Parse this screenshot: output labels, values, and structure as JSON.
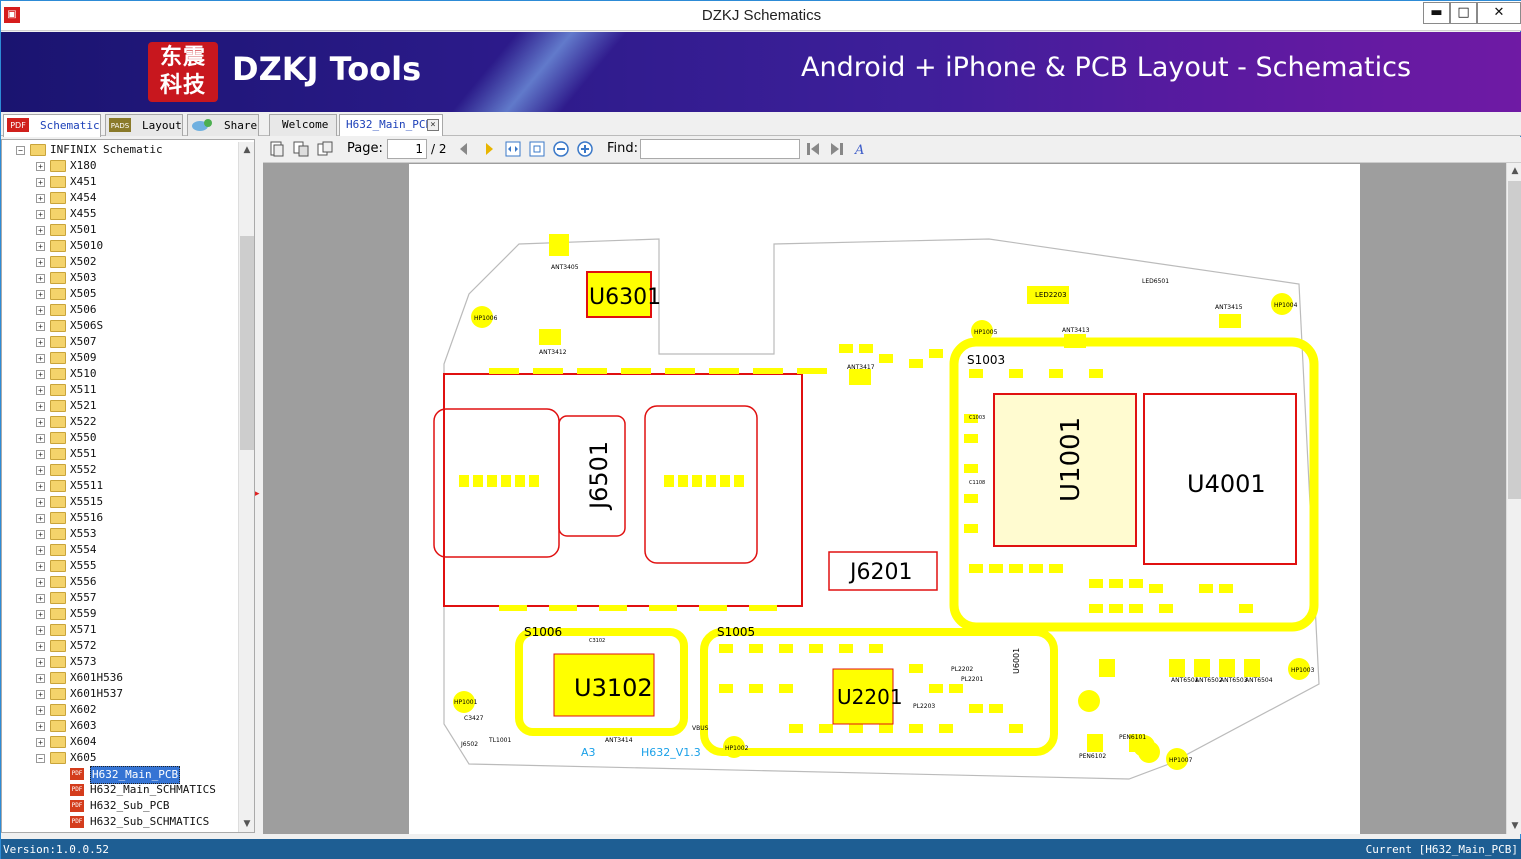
{
  "window": {
    "title": "DZKJ Schematics",
    "min": "▬",
    "max": "□",
    "close": "✕"
  },
  "banner": {
    "logo_text": "东震科技",
    "brand": "DZKJ Tools",
    "tagline": "Android + iPhone & PCB Layout - Schematics"
  },
  "tabs": {
    "left": [
      {
        "label": "Schematic",
        "icon": "pdf-icon"
      },
      {
        "label": "Layout",
        "icon": "pads-icon"
      },
      {
        "label": "Share",
        "icon": "share-icon"
      }
    ],
    "docs": [
      {
        "label": "Welcome"
      },
      {
        "label": "H632_Main_PCB"
      }
    ]
  },
  "tree": {
    "root": "INFINIX Schematic",
    "folders": [
      "X180",
      "X451",
      "X454",
      "X455",
      "X501",
      "X5010",
      "X502",
      "X503",
      "X505",
      "X506",
      "X506S",
      "X507",
      "X509",
      "X510",
      "X511",
      "X521",
      "X522",
      "X550",
      "X551",
      "X552",
      "X5511",
      "X5515",
      "X5516",
      "X553",
      "X554",
      "X555",
      "X556",
      "X557",
      "X559",
      "X571",
      "X572",
      "X573",
      "X601H536",
      "X601H537",
      "X602",
      "X603",
      "X604",
      "X605"
    ],
    "files": [
      "H632_Main_PCB",
      "H632_Main_SCHMATICS",
      "H632_Sub_PCB",
      "H632_Sub_SCHMATICS"
    ],
    "selected": "H632_Main_PCB"
  },
  "toolbar": {
    "page_label": "Page:",
    "page_value": "1",
    "page_total": "/ 2",
    "find_label": "Find:",
    "find_value": ""
  },
  "pcb": {
    "components": [
      "U6301",
      "J6501",
      "J6201",
      "U1001",
      "U4001",
      "U3102",
      "U2201",
      "S1003",
      "S1005",
      "S1006",
      "ANT3405",
      "ANT3412",
      "ANT3415",
      "ANT3413",
      "ANT3417",
      "ANT3414",
      "ANT6501",
      "ANT6502",
      "ANT6503",
      "ANT6504",
      "LED6501",
      "LED2203",
      "HP1006",
      "HP1005",
      "HP1004",
      "HP1001",
      "HP1002",
      "HP1007",
      "HP1003",
      "PEN6101",
      "PEN6102",
      "U6001",
      "PL2201",
      "PL2202",
      "PL2203",
      "A3",
      "H632_V1.3",
      "VBUS",
      "TL1001",
      "J6502",
      "C3427",
      "C1003",
      "C1108",
      "C3102"
    ]
  },
  "status": {
    "version": "Version:1.0.0.52",
    "current": "Current [H632_Main_PCB]"
  },
  "colors": {
    "banner_start": "#1a1470",
    "banner_end": "#6f1aa4",
    "pcb_yellow": "#ffff00",
    "pcb_red": "#e01010",
    "status_bar": "#1e5e93",
    "viewer_bg": "#9e9e9e"
  }
}
